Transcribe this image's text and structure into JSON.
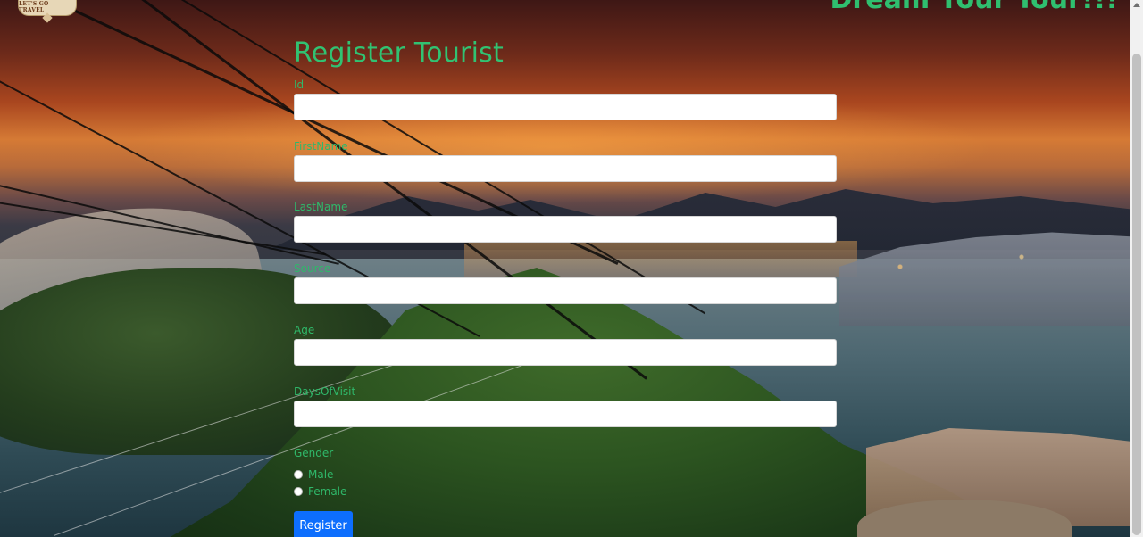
{
  "brand": {
    "logo_text": "LET'S GO TRAVEL",
    "tagline": "Dream Your Tour!!!"
  },
  "form": {
    "title": "Register Tourist",
    "fields": [
      {
        "label": "Id",
        "value": ""
      },
      {
        "label": "FirstName",
        "value": ""
      },
      {
        "label": "LastName",
        "value": ""
      },
      {
        "label": "Source",
        "value": ""
      },
      {
        "label": "Age",
        "value": ""
      },
      {
        "label": "DaysOfVisit",
        "value": ""
      }
    ],
    "gender": {
      "label": "Gender",
      "options": [
        "Male",
        "Female"
      ]
    },
    "submit_label": "Register"
  },
  "colors": {
    "heading": "#31c272",
    "label": "#2fb86a",
    "button": "#0d6efd"
  }
}
